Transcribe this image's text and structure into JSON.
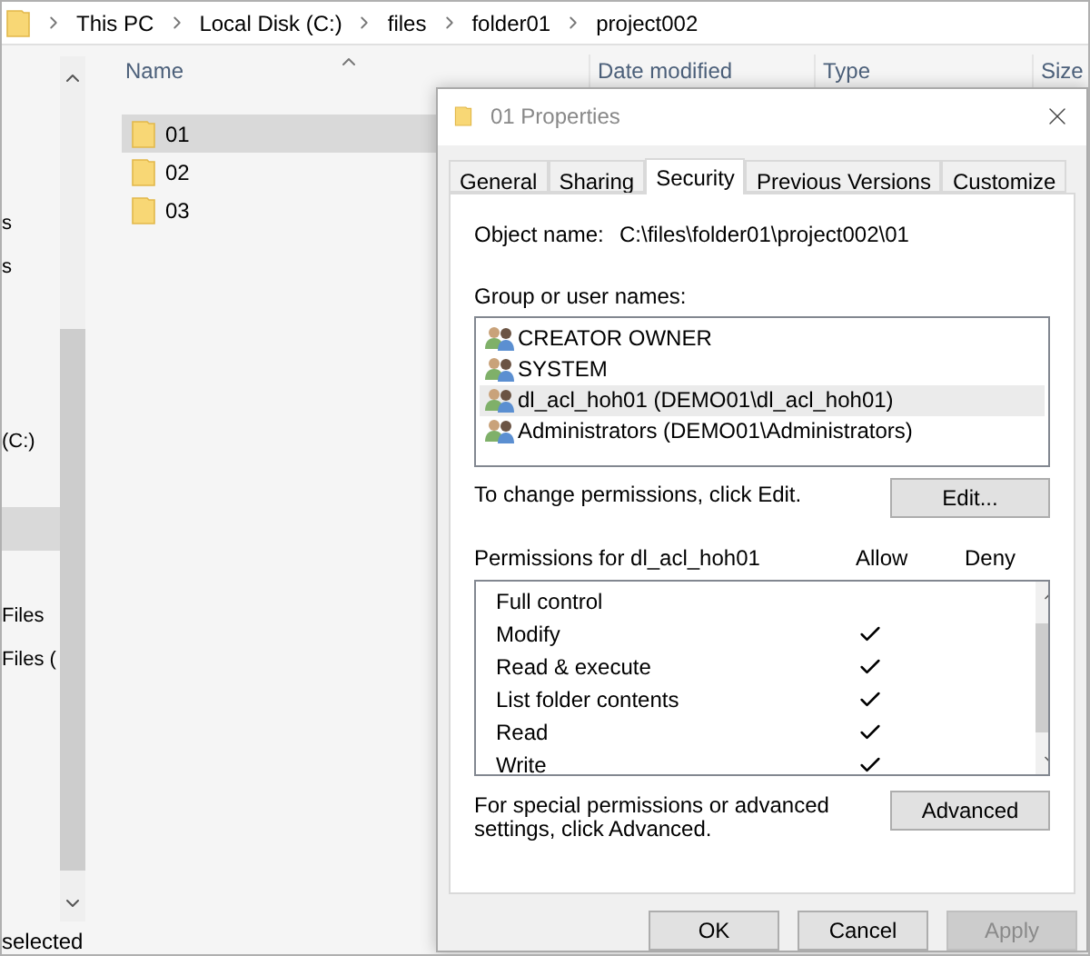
{
  "breadcrumb": [
    "This PC",
    "Local Disk (C:)",
    "files",
    "folder01",
    "project002"
  ],
  "nav_items": [
    {
      "label": "s",
      "selected": false
    },
    {
      "label": "s",
      "selected": false
    },
    {
      "label": "(C:)",
      "selected": false
    },
    {
      "selected": true
    },
    {
      "label": "Files",
      "selected": false
    },
    {
      "label": "Files (",
      "selected": false
    }
  ],
  "columns": [
    "Name",
    "Date modified",
    "Type",
    "Size"
  ],
  "files": [
    {
      "name": "01",
      "selected": true
    },
    {
      "name": "02",
      "selected": false
    },
    {
      "name": "03",
      "selected": false
    }
  ],
  "status_bar": "selected",
  "dialog": {
    "title": "01 Properties",
    "tabs": [
      {
        "label": "General",
        "selected": false
      },
      {
        "label": "Sharing",
        "selected": false
      },
      {
        "label": "Security",
        "selected": true
      },
      {
        "label": "Previous Versions",
        "selected": false
      },
      {
        "label": "Customize",
        "selected": false
      }
    ],
    "object_name_label": "Object name:",
    "object_name_value": "C:\\files\\folder01\\project002\\01",
    "group_label": "Group or user names:",
    "users": [
      {
        "name": "CREATOR OWNER",
        "selected": false
      },
      {
        "name": "SYSTEM",
        "selected": false
      },
      {
        "name": "dl_acl_hoh01 (DEMO01\\dl_acl_hoh01)",
        "selected": true
      },
      {
        "name": "Administrators (DEMO01\\Administrators)",
        "selected": false
      }
    ],
    "change_hint": "To change permissions, click Edit.",
    "edit_button": "Edit...",
    "permissions_label": "Permissions for dl_acl_hoh01",
    "allow_header": "Allow",
    "deny_header": "Deny",
    "permissions": [
      {
        "name": "Full control",
        "allow": false,
        "deny": false
      },
      {
        "name": "Modify",
        "allow": true,
        "deny": false
      },
      {
        "name": "Read & execute",
        "allow": true,
        "deny": false
      },
      {
        "name": "List folder contents",
        "allow": true,
        "deny": false
      },
      {
        "name": "Read",
        "allow": true,
        "deny": false
      },
      {
        "name": "Write",
        "allow": true,
        "deny": false
      }
    ],
    "advanced_hint": "For special permissions or advanced settings, click Advanced.",
    "advanced_button": "Advanced",
    "buttons": [
      {
        "label": "OK",
        "disabled": false
      },
      {
        "label": "Cancel",
        "disabled": false
      },
      {
        "label": "Apply",
        "disabled": true
      }
    ]
  }
}
